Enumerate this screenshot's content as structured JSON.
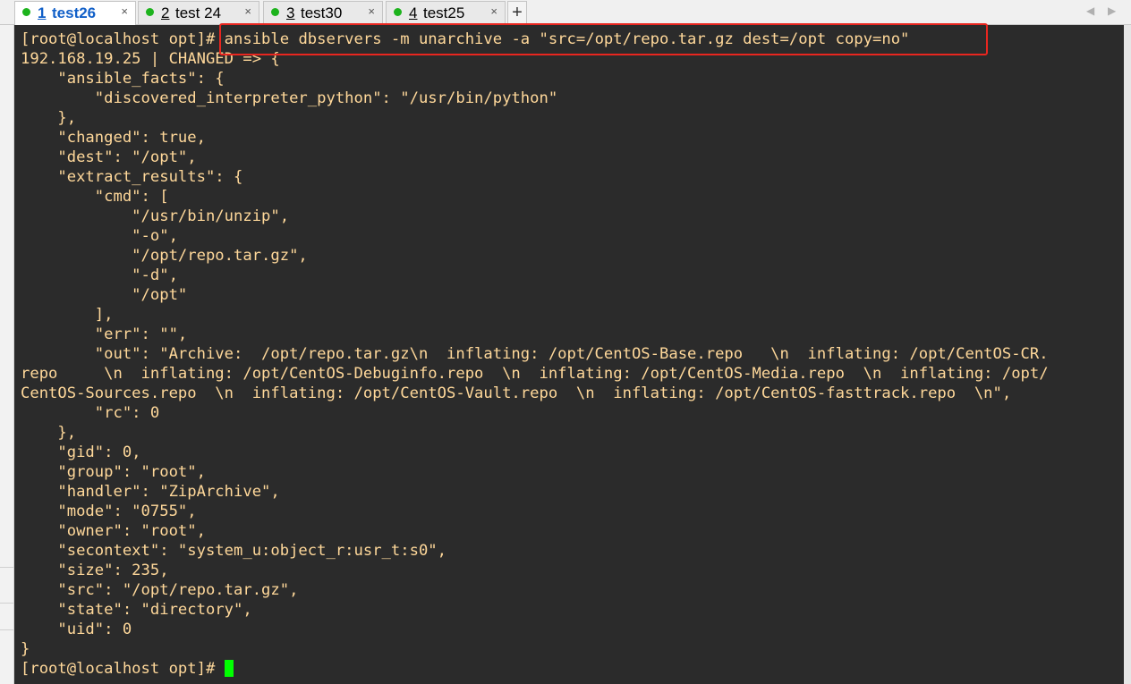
{
  "tabs": [
    {
      "number": "1",
      "name": "test26",
      "active": true
    },
    {
      "number": "2",
      "name": "test 24",
      "active": false
    },
    {
      "number": "3",
      "name": "test30",
      "active": false
    },
    {
      "number": "4",
      "name": "test25",
      "active": false
    }
  ],
  "tab_close_glyph": "×",
  "new_tab_glyph": "+",
  "status_color": "#1db31d",
  "highlight_color": "#e8261f",
  "terminal": {
    "prompt": "[root@localhost opt]#",
    "command": " ansible dbservers -m unarchive -a \"src=/opt/repo.tar.gz dest=/opt copy=no\"",
    "output_lines": [
      "192.168.19.25 | CHANGED => {",
      "    \"ansible_facts\": {",
      "        \"discovered_interpreter_python\": \"/usr/bin/python\"",
      "    },",
      "    \"changed\": true,",
      "    \"dest\": \"/opt\",",
      "    \"extract_results\": {",
      "        \"cmd\": [",
      "            \"/usr/bin/unzip\",",
      "            \"-o\",",
      "            \"/opt/repo.tar.gz\",",
      "            \"-d\",",
      "            \"/opt\"",
      "        ],",
      "        \"err\": \"\",",
      "        \"out\": \"Archive:  /opt/repo.tar.gz\\n  inflating: /opt/CentOS-Base.repo   \\n  inflating: /opt/CentOS-CR.",
      "repo     \\n  inflating: /opt/CentOS-Debuginfo.repo  \\n  inflating: /opt/CentOS-Media.repo  \\n  inflating: /opt/",
      "CentOS-Sources.repo  \\n  inflating: /opt/CentOS-Vault.repo  \\n  inflating: /opt/CentOS-fasttrack.repo  \\n\",",
      "        \"rc\": 0",
      "    },",
      "    \"gid\": 0,",
      "    \"group\": \"root\",",
      "    \"handler\": \"ZipArchive\",",
      "    \"mode\": \"0755\",",
      "    \"owner\": \"root\",",
      "    \"secontext\": \"system_u:object_r:usr_t:s0\",",
      "    \"size\": 235,",
      "    \"src\": \"/opt/repo.tar.gz\",",
      "    \"state\": \"directory\",",
      "    \"uid\": 0",
      "}"
    ],
    "final_prompt": "[root@localhost opt]#",
    "text_color": "#ffd89a",
    "background": "#2b2b2b",
    "cursor_color": "#00ff00"
  }
}
